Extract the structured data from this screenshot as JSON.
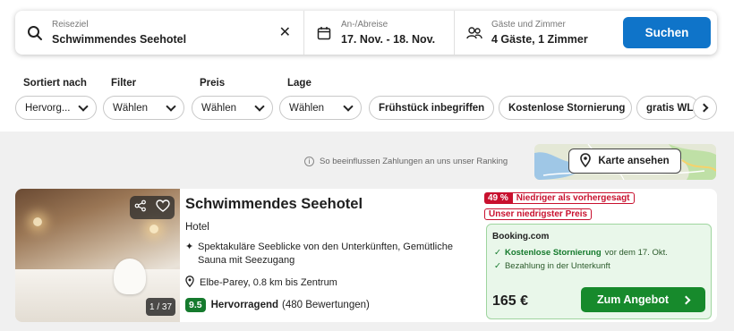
{
  "search": {
    "destination_label": "Reiseziel",
    "destination_value": "Schwimmendes Seehotel",
    "dates_label": "An-/Abreise",
    "dates_value": "17. Nov. - 18. Nov.",
    "guests_label": "Gäste und Zimmer",
    "guests_value": "4 Gäste, 1 Zimmer",
    "search_button": "Suchen"
  },
  "filters": {
    "sort_label": "Sortiert nach",
    "sort_value": "Hervorg...",
    "filter_label": "Filter",
    "filter_value": "Wählen",
    "price_label": "Preis",
    "price_value": "Wählen",
    "location_label": "Lage",
    "location_value": "Wählen",
    "chips": [
      "Frühstück inbegriffen",
      "Kostenlose Stornierung",
      "gratis WLAN"
    ]
  },
  "ranking_note": "So beeinflussen Zahlungen an uns unser Ranking",
  "map_button": "Karte ansehen",
  "result": {
    "photo_counter": "1 / 37",
    "name": "Schwimmendes Seehotel",
    "type": "Hotel",
    "highlight": "Spektakuläre Seeblicke von den Unterkünften, Gemütliche Sauna mit Seezugang",
    "location": "Elbe-Parey, 0.8 km bis Zentrum",
    "rating_score": "9.5",
    "rating_word": "Hervorragend",
    "rating_count": "(480 Bewertungen)",
    "discount_pct": "49 %",
    "discount_text": "Niedriger als vorhergesagt",
    "lowest_price_badge": "Unser niedrigster Preis",
    "provider": "Booking.com",
    "perk1_bold": "Kostenlose Stornierung",
    "perk1_rest": "vor dem 17. Okt.",
    "perk2": "Bezahlung in der Unterkunft",
    "price": "165 €",
    "cta": "Zum Angebot"
  }
}
